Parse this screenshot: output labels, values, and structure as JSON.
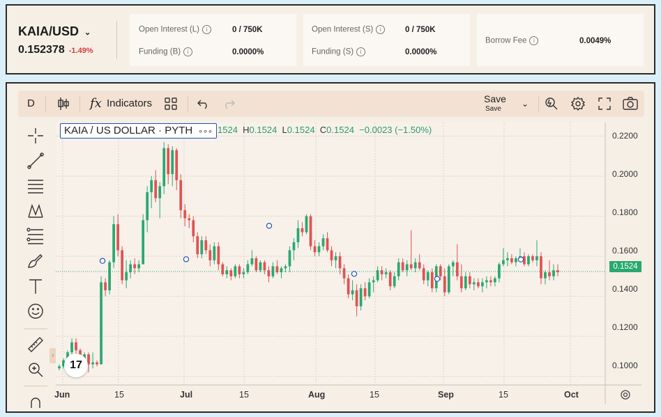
{
  "market": {
    "pair": "KAIA/USD",
    "price": "0.152378",
    "change": "-1.49%"
  },
  "stats": [
    {
      "label": "Open Interest (L)",
      "value": "0 / 750K"
    },
    {
      "label": "Funding (B)",
      "value": "0.0000%"
    },
    {
      "label": "Open Interest (S)",
      "value": "0 / 750K"
    },
    {
      "label": "Funding (S)",
      "value": "0.0000%"
    },
    {
      "label": "Borrow Fee",
      "value": "0.0049%"
    }
  ],
  "toolbar": {
    "interval": "D",
    "indicators_label": "Indicators",
    "save_label": "Save",
    "save_sub": "Save",
    "fx_glyph": "fx"
  },
  "legend": {
    "symbol": "KAIA / US DOLLAR · PYTH",
    "more": "∘∘∘",
    "o_val": "1524",
    "h_label": "H",
    "h_val": "0.1524",
    "l_label": "L",
    "l_val": "0.1524",
    "c_label": "C",
    "c_val": "0.1524",
    "change": "−0.0023 (−1.50%)"
  },
  "last_price": "0.1524",
  "logo": "17",
  "collapse": "‹",
  "colors": {
    "up": "#2aa870",
    "down": "#e05252",
    "accent": "#2050b8"
  },
  "chart_data": {
    "type": "candlestick",
    "y_ticks": [
      "0.2200",
      "0.2000",
      "0.1800",
      "0.1600",
      "0.1400",
      "0.1200",
      "0.1000"
    ],
    "ylim": [
      0.0957,
      0.2268
    ],
    "x_ticks": [
      "Jun",
      "15",
      "Jul",
      "15",
      "Aug",
      "15",
      "Sep",
      "15",
      "Oct"
    ],
    "ohlc": [
      [
        0.104,
        0.106,
        0.103,
        0.105
      ],
      [
        0.105,
        0.109,
        0.104,
        0.108
      ],
      [
        0.108,
        0.113,
        0.107,
        0.112
      ],
      [
        0.112,
        0.119,
        0.111,
        0.117
      ],
      [
        0.117,
        0.119,
        0.11,
        0.113
      ],
      [
        0.113,
        0.114,
        0.103,
        0.105
      ],
      [
        0.105,
        0.112,
        0.104,
        0.111
      ],
      [
        0.111,
        0.112,
        0.102,
        0.106
      ],
      [
        0.106,
        0.112,
        0.104,
        0.107
      ],
      [
        0.107,
        0.108,
        0.105,
        0.106
      ],
      [
        0.106,
        0.15,
        0.106,
        0.147
      ],
      [
        0.147,
        0.149,
        0.14,
        0.143
      ],
      [
        0.143,
        0.158,
        0.141,
        0.157
      ],
      [
        0.157,
        0.18,
        0.154,
        0.176
      ],
      [
        0.176,
        0.181,
        0.16,
        0.163
      ],
      [
        0.163,
        0.165,
        0.146,
        0.148
      ],
      [
        0.148,
        0.158,
        0.144,
        0.152
      ],
      [
        0.152,
        0.158,
        0.149,
        0.156
      ],
      [
        0.156,
        0.159,
        0.151,
        0.154
      ],
      [
        0.154,
        0.158,
        0.152,
        0.156
      ],
      [
        0.156,
        0.181,
        0.156,
        0.178
      ],
      [
        0.178,
        0.195,
        0.172,
        0.192
      ],
      [
        0.192,
        0.2,
        0.184,
        0.198
      ],
      [
        0.198,
        0.203,
        0.187,
        0.189
      ],
      [
        0.189,
        0.197,
        0.179,
        0.195
      ],
      [
        0.195,
        0.217,
        0.191,
        0.214
      ],
      [
        0.214,
        0.216,
        0.196,
        0.201
      ],
      [
        0.201,
        0.215,
        0.195,
        0.213
      ],
      [
        0.213,
        0.214,
        0.193,
        0.198
      ],
      [
        0.198,
        0.201,
        0.179,
        0.183
      ],
      [
        0.183,
        0.186,
        0.175,
        0.179
      ],
      [
        0.179,
        0.181,
        0.174,
        0.178
      ],
      [
        0.178,
        0.18,
        0.167,
        0.17
      ],
      [
        0.17,
        0.172,
        0.159,
        0.161
      ],
      [
        0.161,
        0.17,
        0.159,
        0.168
      ],
      [
        0.168,
        0.17,
        0.161,
        0.163
      ],
      [
        0.163,
        0.166,
        0.155,
        0.158
      ],
      [
        0.158,
        0.167,
        0.156,
        0.165
      ],
      [
        0.165,
        0.167,
        0.153,
        0.156
      ],
      [
        0.156,
        0.157,
        0.15,
        0.151
      ],
      [
        0.151,
        0.155,
        0.149,
        0.153
      ],
      [
        0.153,
        0.154,
        0.148,
        0.15
      ],
      [
        0.15,
        0.156,
        0.149,
        0.155
      ],
      [
        0.155,
        0.156,
        0.149,
        0.151
      ],
      [
        0.151,
        0.154,
        0.149,
        0.152
      ],
      [
        0.152,
        0.158,
        0.151,
        0.156
      ],
      [
        0.156,
        0.163,
        0.155,
        0.159
      ],
      [
        0.159,
        0.16,
        0.152,
        0.153
      ],
      [
        0.153,
        0.158,
        0.152,
        0.157
      ],
      [
        0.157,
        0.158,
        0.151,
        0.153
      ],
      [
        0.153,
        0.155,
        0.147,
        0.15
      ],
      [
        0.15,
        0.157,
        0.149,
        0.155
      ],
      [
        0.155,
        0.158,
        0.151,
        0.152
      ],
      [
        0.152,
        0.155,
        0.149,
        0.154
      ],
      [
        0.154,
        0.156,
        0.152,
        0.155
      ],
      [
        0.155,
        0.165,
        0.152,
        0.163
      ],
      [
        0.163,
        0.169,
        0.158,
        0.167
      ],
      [
        0.167,
        0.178,
        0.164,
        0.174
      ],
      [
        0.174,
        0.177,
        0.17,
        0.172
      ],
      [
        0.172,
        0.181,
        0.171,
        0.18
      ],
      [
        0.18,
        0.181,
        0.163,
        0.165
      ],
      [
        0.165,
        0.168,
        0.16,
        0.162
      ],
      [
        0.162,
        0.167,
        0.16,
        0.165
      ],
      [
        0.165,
        0.171,
        0.163,
        0.169
      ],
      [
        0.169,
        0.172,
        0.162,
        0.163
      ],
      [
        0.163,
        0.165,
        0.155,
        0.158
      ],
      [
        0.158,
        0.162,
        0.154,
        0.16
      ],
      [
        0.16,
        0.162,
        0.151,
        0.154
      ],
      [
        0.154,
        0.156,
        0.146,
        0.149
      ],
      [
        0.149,
        0.151,
        0.139,
        0.141
      ],
      [
        0.141,
        0.148,
        0.138,
        0.143
      ],
      [
        0.143,
        0.146,
        0.13,
        0.135
      ],
      [
        0.135,
        0.146,
        0.133,
        0.144
      ],
      [
        0.144,
        0.147,
        0.138,
        0.14
      ],
      [
        0.14,
        0.149,
        0.139,
        0.147
      ],
      [
        0.147,
        0.15,
        0.142,
        0.148
      ],
      [
        0.148,
        0.155,
        0.147,
        0.153
      ],
      [
        0.153,
        0.155,
        0.148,
        0.151
      ],
      [
        0.151,
        0.154,
        0.149,
        0.152
      ],
      [
        0.152,
        0.153,
        0.143,
        0.145
      ],
      [
        0.145,
        0.152,
        0.144,
        0.15
      ],
      [
        0.15,
        0.159,
        0.148,
        0.157
      ],
      [
        0.157,
        0.159,
        0.152,
        0.153
      ],
      [
        0.153,
        0.158,
        0.15,
        0.156
      ],
      [
        0.156,
        0.173,
        0.153,
        0.154
      ],
      [
        0.154,
        0.159,
        0.152,
        0.157
      ],
      [
        0.157,
        0.161,
        0.153,
        0.154
      ],
      [
        0.154,
        0.156,
        0.146,
        0.148
      ],
      [
        0.148,
        0.153,
        0.145,
        0.152
      ],
      [
        0.152,
        0.154,
        0.142,
        0.144
      ],
      [
        0.144,
        0.156,
        0.142,
        0.155
      ],
      [
        0.155,
        0.156,
        0.148,
        0.15
      ],
      [
        0.15,
        0.154,
        0.14,
        0.142
      ],
      [
        0.142,
        0.156,
        0.141,
        0.155
      ],
      [
        0.155,
        0.158,
        0.15,
        0.157
      ],
      [
        0.157,
        0.166,
        0.148,
        0.15
      ],
      [
        0.15,
        0.156,
        0.142,
        0.144
      ],
      [
        0.144,
        0.152,
        0.143,
        0.15
      ],
      [
        0.15,
        0.152,
        0.144,
        0.146
      ],
      [
        0.146,
        0.149,
        0.143,
        0.147
      ],
      [
        0.147,
        0.149,
        0.144,
        0.145
      ],
      [
        0.145,
        0.149,
        0.142,
        0.147
      ],
      [
        0.147,
        0.15,
        0.144,
        0.148
      ],
      [
        0.148,
        0.15,
        0.145,
        0.147
      ],
      [
        0.147,
        0.15,
        0.145,
        0.149
      ],
      [
        0.149,
        0.157,
        0.147,
        0.156
      ],
      [
        0.156,
        0.164,
        0.155,
        0.158
      ],
      [
        0.158,
        0.162,
        0.155,
        0.159
      ],
      [
        0.159,
        0.161,
        0.156,
        0.157
      ],
      [
        0.157,
        0.16,
        0.155,
        0.159
      ],
      [
        0.159,
        0.164,
        0.157,
        0.16
      ],
      [
        0.16,
        0.162,
        0.155,
        0.156
      ],
      [
        0.156,
        0.161,
        0.155,
        0.16
      ],
      [
        0.16,
        0.161,
        0.157,
        0.158
      ],
      [
        0.158,
        0.168,
        0.155,
        0.16
      ],
      [
        0.16,
        0.162,
        0.146,
        0.149
      ],
      [
        0.149,
        0.153,
        0.146,
        0.152
      ],
      [
        0.152,
        0.158,
        0.148,
        0.15
      ],
      [
        0.15,
        0.156,
        0.148,
        0.153
      ],
      [
        0.153,
        0.156,
        0.15,
        0.152
      ]
    ]
  }
}
